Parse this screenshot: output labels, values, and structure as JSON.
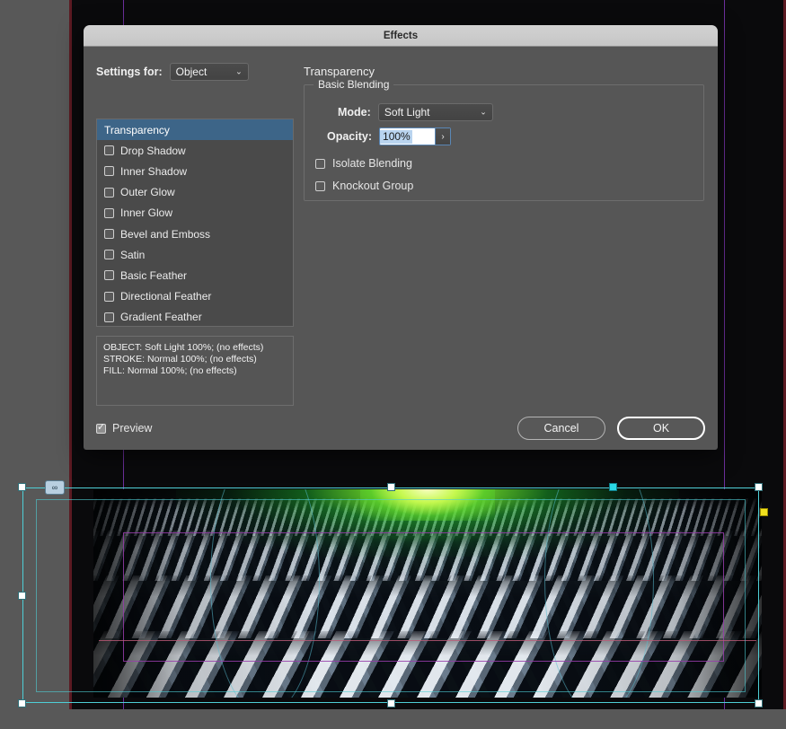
{
  "dialog": {
    "title": "Effects",
    "settings_for_label": "Settings for:",
    "settings_for_value": "Object",
    "panel_title": "Transparency",
    "effects": [
      {
        "label": "Transparency",
        "checkbox": false,
        "selected": true
      },
      {
        "label": "Drop Shadow",
        "checkbox": true,
        "checked": false,
        "selected": false
      },
      {
        "label": "Inner Shadow",
        "checkbox": true,
        "checked": false,
        "selected": false
      },
      {
        "label": "Outer Glow",
        "checkbox": true,
        "checked": false,
        "selected": false
      },
      {
        "label": "Inner Glow",
        "checkbox": true,
        "checked": false,
        "selected": false
      },
      {
        "label": "Bevel and Emboss",
        "checkbox": true,
        "checked": false,
        "selected": false
      },
      {
        "label": "Satin",
        "checkbox": true,
        "checked": false,
        "selected": false
      },
      {
        "label": "Basic Feather",
        "checkbox": true,
        "checked": false,
        "selected": false
      },
      {
        "label": "Directional Feather",
        "checkbox": true,
        "checked": false,
        "selected": false
      },
      {
        "label": "Gradient Feather",
        "checkbox": true,
        "checked": false,
        "selected": false
      }
    ],
    "summary": "OBJECT: Soft Light 100%; (no effects)\nSTROKE: Normal 100%; (no effects)\nFILL: Normal 100%; (no effects)",
    "basic_blending": {
      "legend": "Basic Blending",
      "mode_label": "Mode:",
      "mode_value": "Soft Light",
      "opacity_label": "Opacity:",
      "opacity_value": "100%",
      "isolate_blending_label": "Isolate Blending",
      "isolate_blending_checked": false,
      "knockout_group_label": "Knockout Group",
      "knockout_group_checked": false
    },
    "footer": {
      "preview_label": "Preview",
      "preview_checked": true,
      "cancel_label": "Cancel",
      "ok_label": "OK"
    }
  },
  "canvas": {
    "link_badge_glyph": "∞",
    "selection_accent": "#4ecfd6",
    "guide_color": "#6c2f9c",
    "bleed_color": "#5c1a22",
    "glow_color": "#7ae62a"
  }
}
